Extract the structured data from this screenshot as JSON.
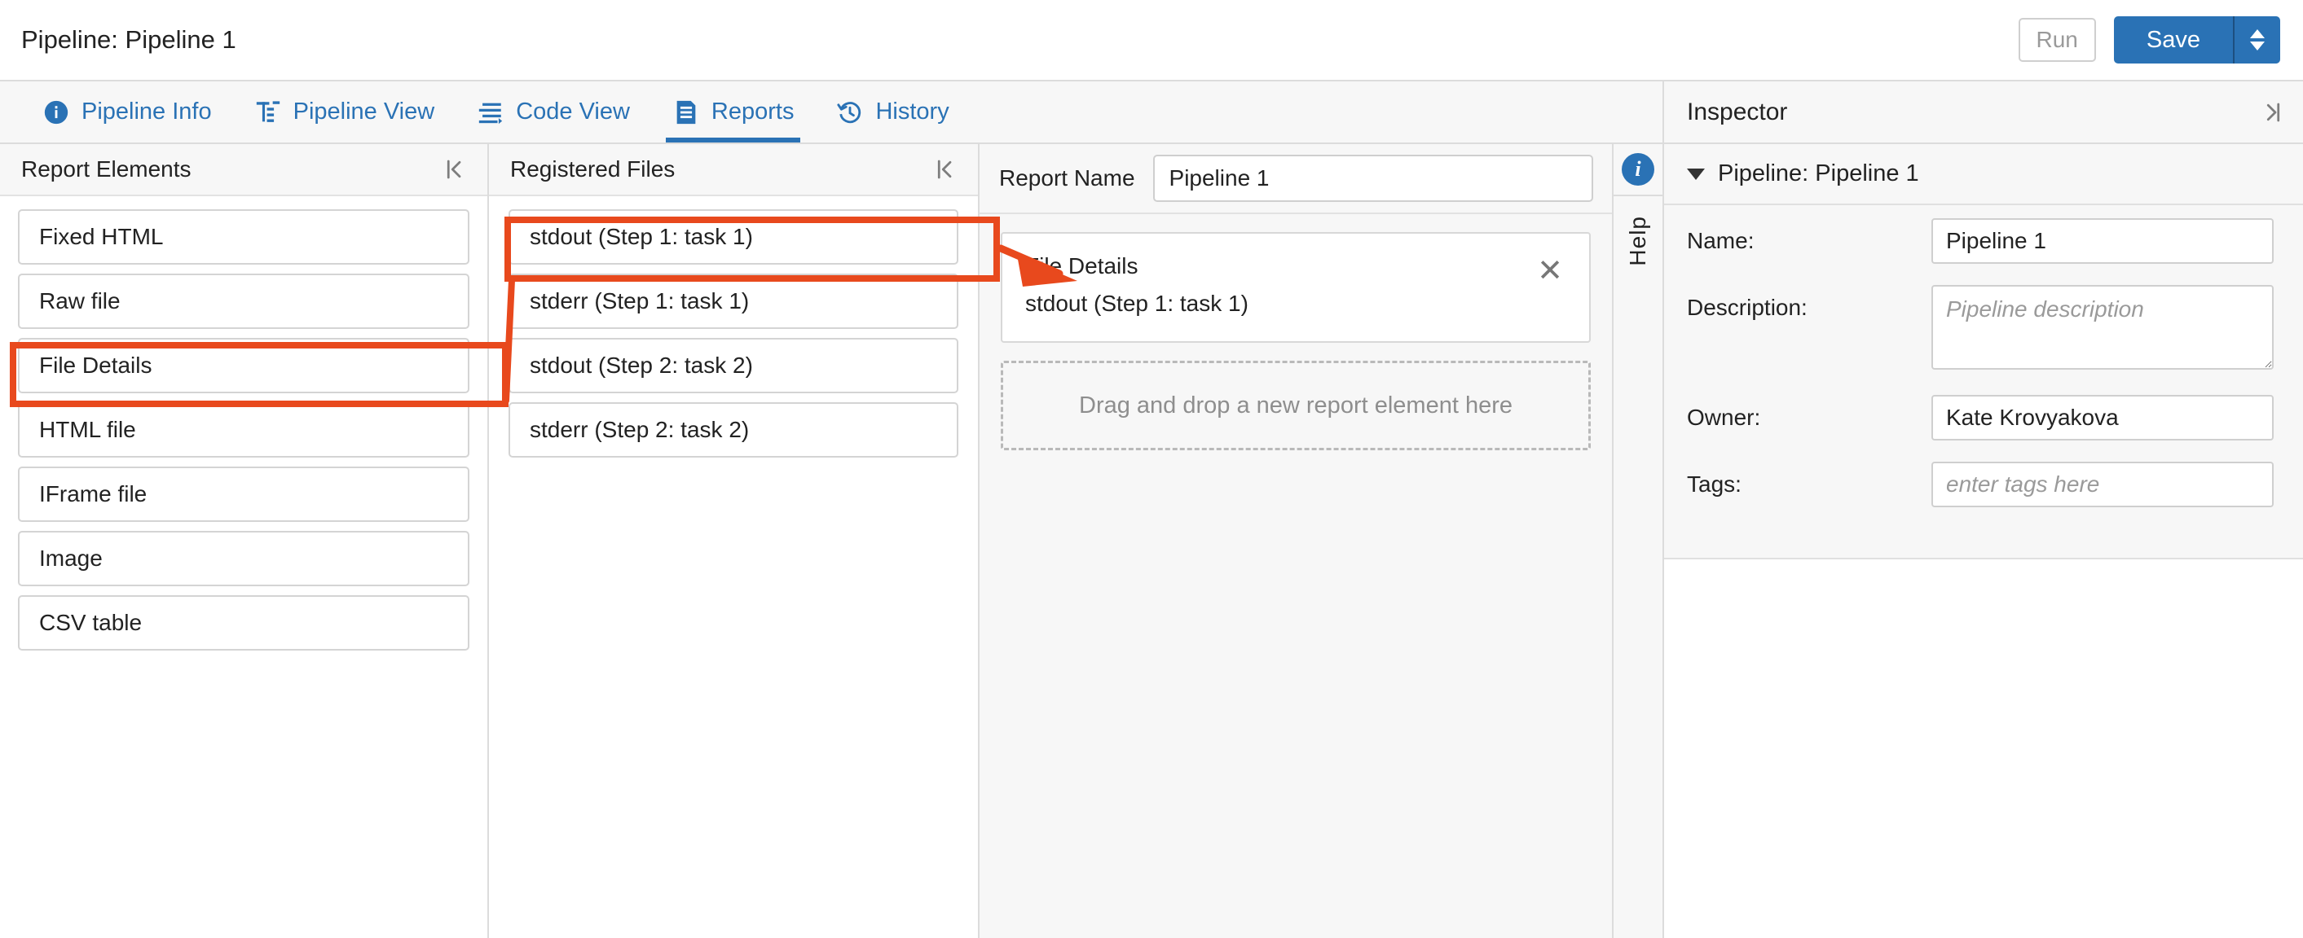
{
  "window": {
    "title": "Pipeline: Pipeline 1",
    "run_label": "Run",
    "save_label": "Save"
  },
  "tabs": [
    {
      "label": "Pipeline Info",
      "icon": "info-circle-icon",
      "active": false
    },
    {
      "label": "Pipeline View",
      "icon": "pipeline-tree-icon",
      "active": false
    },
    {
      "label": "Code View",
      "icon": "code-lines-icon",
      "active": false
    },
    {
      "label": "Reports",
      "icon": "document-icon",
      "active": true
    },
    {
      "label": "History",
      "icon": "clock-history-icon",
      "active": false
    }
  ],
  "report_elements": {
    "header": "Report Elements",
    "collapse_icon": "collapse-left-icon",
    "items": [
      {
        "label": "Fixed HTML",
        "highlighted": false
      },
      {
        "label": "Raw file",
        "highlighted": false
      },
      {
        "label": "File Details",
        "highlighted": true
      },
      {
        "label": "HTML file",
        "highlighted": false
      },
      {
        "label": "IFrame file",
        "highlighted": false
      },
      {
        "label": "Image",
        "highlighted": false
      },
      {
        "label": "CSV table",
        "highlighted": false
      }
    ]
  },
  "registered_files": {
    "header": "Registered Files",
    "collapse_icon": "collapse-left-icon",
    "items": [
      {
        "label": "stdout (Step 1: task 1)",
        "highlighted": true
      },
      {
        "label": "stderr (Step 1: task 1)",
        "highlighted": false
      },
      {
        "label": "stdout (Step 2: task 2)",
        "highlighted": false
      },
      {
        "label": "stderr (Step 2: task 2)",
        "highlighted": false
      }
    ]
  },
  "report": {
    "name_label": "Report Name",
    "name_value": "Pipeline 1",
    "card": {
      "title": "File Details",
      "subtitle": "stdout (Step 1: task 1)",
      "close_glyph": "✕"
    },
    "dropzone_text": "Drag and drop a new report element here"
  },
  "help_rail": {
    "info_glyph": "i",
    "label": "Help"
  },
  "inspector": {
    "header": "Inspector",
    "collapse_icon": "collapse-right-icon",
    "section_title": "Pipeline: Pipeline 1",
    "fields": [
      {
        "label": "Name:",
        "value": "Pipeline 1",
        "placeholder": "",
        "type": "input"
      },
      {
        "label": "Description:",
        "value": "",
        "placeholder": "Pipeline description",
        "type": "textarea"
      },
      {
        "label": "Owner:",
        "value": "Kate Krovyakova",
        "placeholder": "",
        "type": "input"
      },
      {
        "label": "Tags:",
        "value": "",
        "placeholder": "enter tags here",
        "type": "input"
      }
    ]
  },
  "annotation": {
    "color": "#e8491d",
    "description": "Orange callout boxes around 'File Details' element and 'stdout (Step 1: task 1)' file, with an arrow pointing to the File Details report card"
  },
  "colors": {
    "accent": "#2a72b5",
    "annotation": "#e8491d",
    "panel_bg": "#f7f7f7",
    "border": "#dcdcdc"
  }
}
